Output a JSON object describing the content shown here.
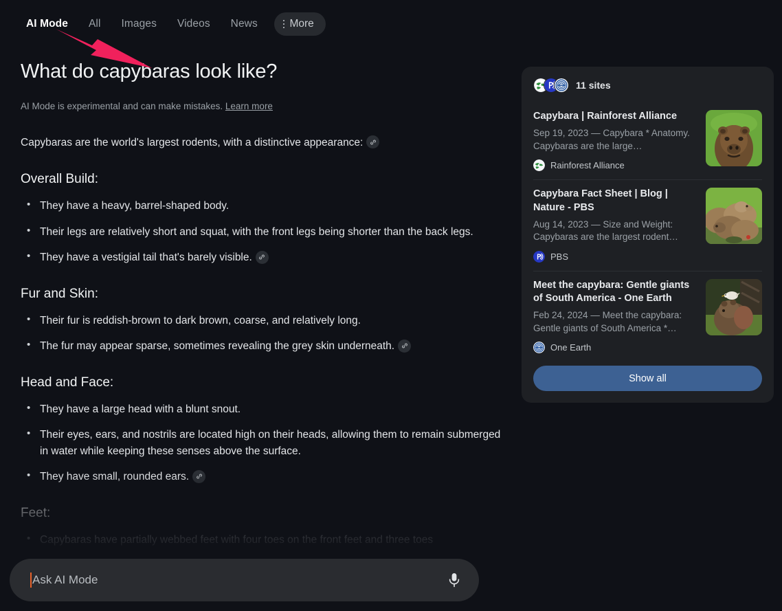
{
  "nav": {
    "tabs": [
      {
        "label": "AI Mode",
        "active": true
      },
      {
        "label": "All",
        "active": false
      },
      {
        "label": "Images",
        "active": false
      },
      {
        "label": "Videos",
        "active": false
      },
      {
        "label": "News",
        "active": false
      }
    ],
    "more_label": "More"
  },
  "annotation": {
    "arrow_color": "#f0215c",
    "points_to": "AI Mode"
  },
  "main": {
    "title": "What do capybaras look like?",
    "disclaimer_text": "AI Mode is experimental and can make mistakes.",
    "disclaimer_link": "Learn more",
    "intro": "Capybaras are the world's largest rodents, with a distinctive appearance:",
    "sections": [
      {
        "heading": "Overall Build:",
        "bullets": [
          {
            "text": "They have a heavy, barrel-shaped body.",
            "cite": false
          },
          {
            "text": "Their legs are relatively short and squat, with the front legs being shorter than the back legs.",
            "cite": false
          },
          {
            "text": "They have a vestigial tail that's barely visible.",
            "cite": true
          }
        ]
      },
      {
        "heading": "Fur and Skin:",
        "bullets": [
          {
            "text": "Their fur is reddish-brown to dark brown, coarse, and relatively long.",
            "cite": false
          },
          {
            "text": "The fur may appear sparse, sometimes revealing the grey skin underneath.",
            "cite": true
          }
        ]
      },
      {
        "heading": "Head and Face:",
        "bullets": [
          {
            "text": "They have a large head with a blunt snout.",
            "cite": false
          },
          {
            "text": "Their eyes, ears, and nostrils are located high on their heads, allowing them to remain submerged in water while keeping these senses above the surface.",
            "cite": false
          },
          {
            "text": "They have small, rounded ears.",
            "cite": true
          }
        ]
      },
      {
        "heading": "Feet:",
        "bullets": [
          {
            "text": "Capybaras have partially webbed feet with four toes on the front feet and three toes",
            "cite": false
          }
        ]
      }
    ]
  },
  "sources": {
    "sites_count_label": "11 sites",
    "show_all_label": "Show all",
    "items": [
      {
        "title": "Capybara | Rainforest Alliance",
        "snippet": "Sep 19, 2023 — Capybara * Anatomy. Capybaras are the large…",
        "origin": "Rainforest Alliance",
        "thumb_alt": "capybara-headshot-thumbnail"
      },
      {
        "title": "Capybara Fact Sheet | Blog | Nature - PBS",
        "snippet": "Aug 14, 2023 — Size and Weight: Capybaras are the largest rodent…",
        "origin": "PBS",
        "thumb_alt": "capybara-group-thumbnail"
      },
      {
        "title": "Meet the capybara: Gentle giants of South America - One Earth",
        "snippet": "Feb 24, 2024 — Meet the capybara: Gentle giants of South America *…",
        "origin": "One Earth",
        "thumb_alt": "capybara-with-bird-thumbnail"
      }
    ]
  },
  "search": {
    "placeholder": "Ask AI Mode",
    "value": ""
  },
  "colors": {
    "page_background": "#0f1117",
    "card_background": "#1e2024",
    "accent_button": "#3d6193",
    "annotation_pink": "#f0215c",
    "caret": "#e8622a"
  }
}
